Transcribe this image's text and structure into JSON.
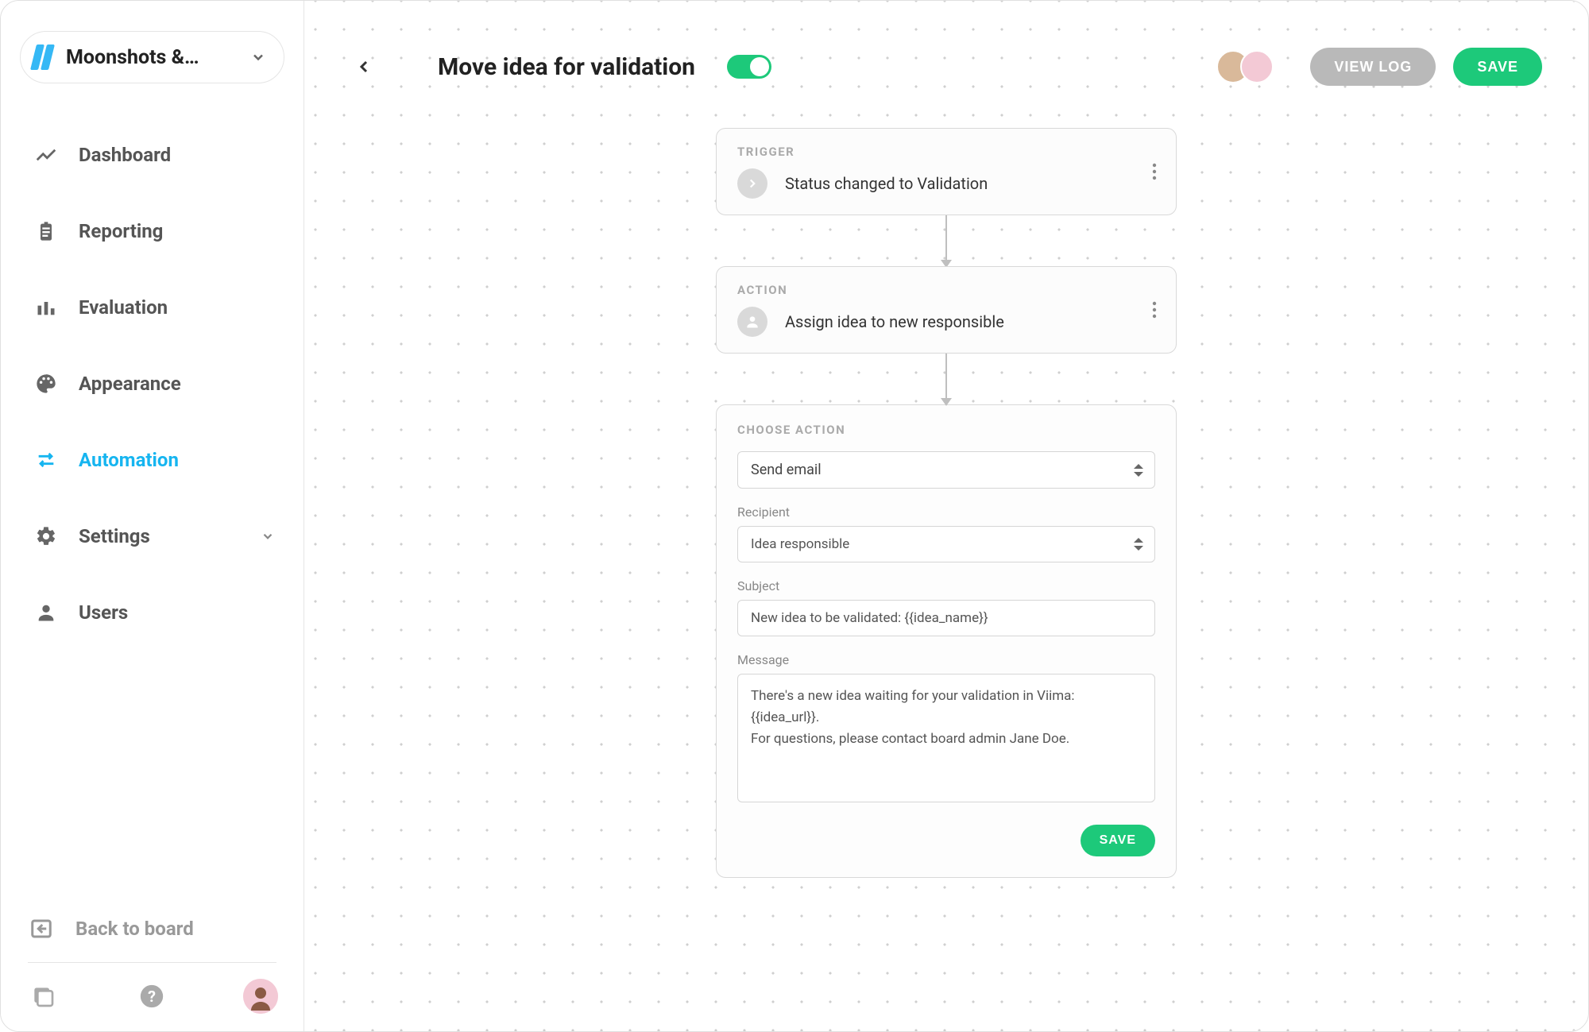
{
  "board_selector": {
    "name": "Moonshots &…"
  },
  "nav": {
    "items": [
      {
        "key": "dashboard",
        "label": "Dashboard"
      },
      {
        "key": "reporting",
        "label": "Reporting"
      },
      {
        "key": "evaluation",
        "label": "Evaluation"
      },
      {
        "key": "appearance",
        "label": "Appearance"
      },
      {
        "key": "automation",
        "label": "Automation"
      },
      {
        "key": "settings",
        "label": "Settings"
      },
      {
        "key": "users",
        "label": "Users"
      }
    ],
    "active": "automation"
  },
  "back_to_board": {
    "label": "Back to board"
  },
  "header": {
    "title": "Move idea for validation",
    "toggle_on": true,
    "view_log": "VIEW LOG",
    "save": "SAVE"
  },
  "flow": {
    "trigger": {
      "section": "TRIGGER",
      "text": "Status changed to Validation"
    },
    "action": {
      "section": "ACTION",
      "text": "Assign idea to new responsible"
    },
    "choose_action": {
      "section": "CHOOSE ACTION",
      "action_select": "Send email",
      "recipient_label": "Recipient",
      "recipient_value": "Idea responsible",
      "subject_label": "Subject",
      "subject_value": "New idea to be validated: {{idea_name}}",
      "message_label": "Message",
      "message_value": "There's a new idea waiting for your validation in Viima: {{idea_url}}.\nFor questions, please contact board admin Jane Doe.",
      "save": "SAVE"
    }
  }
}
